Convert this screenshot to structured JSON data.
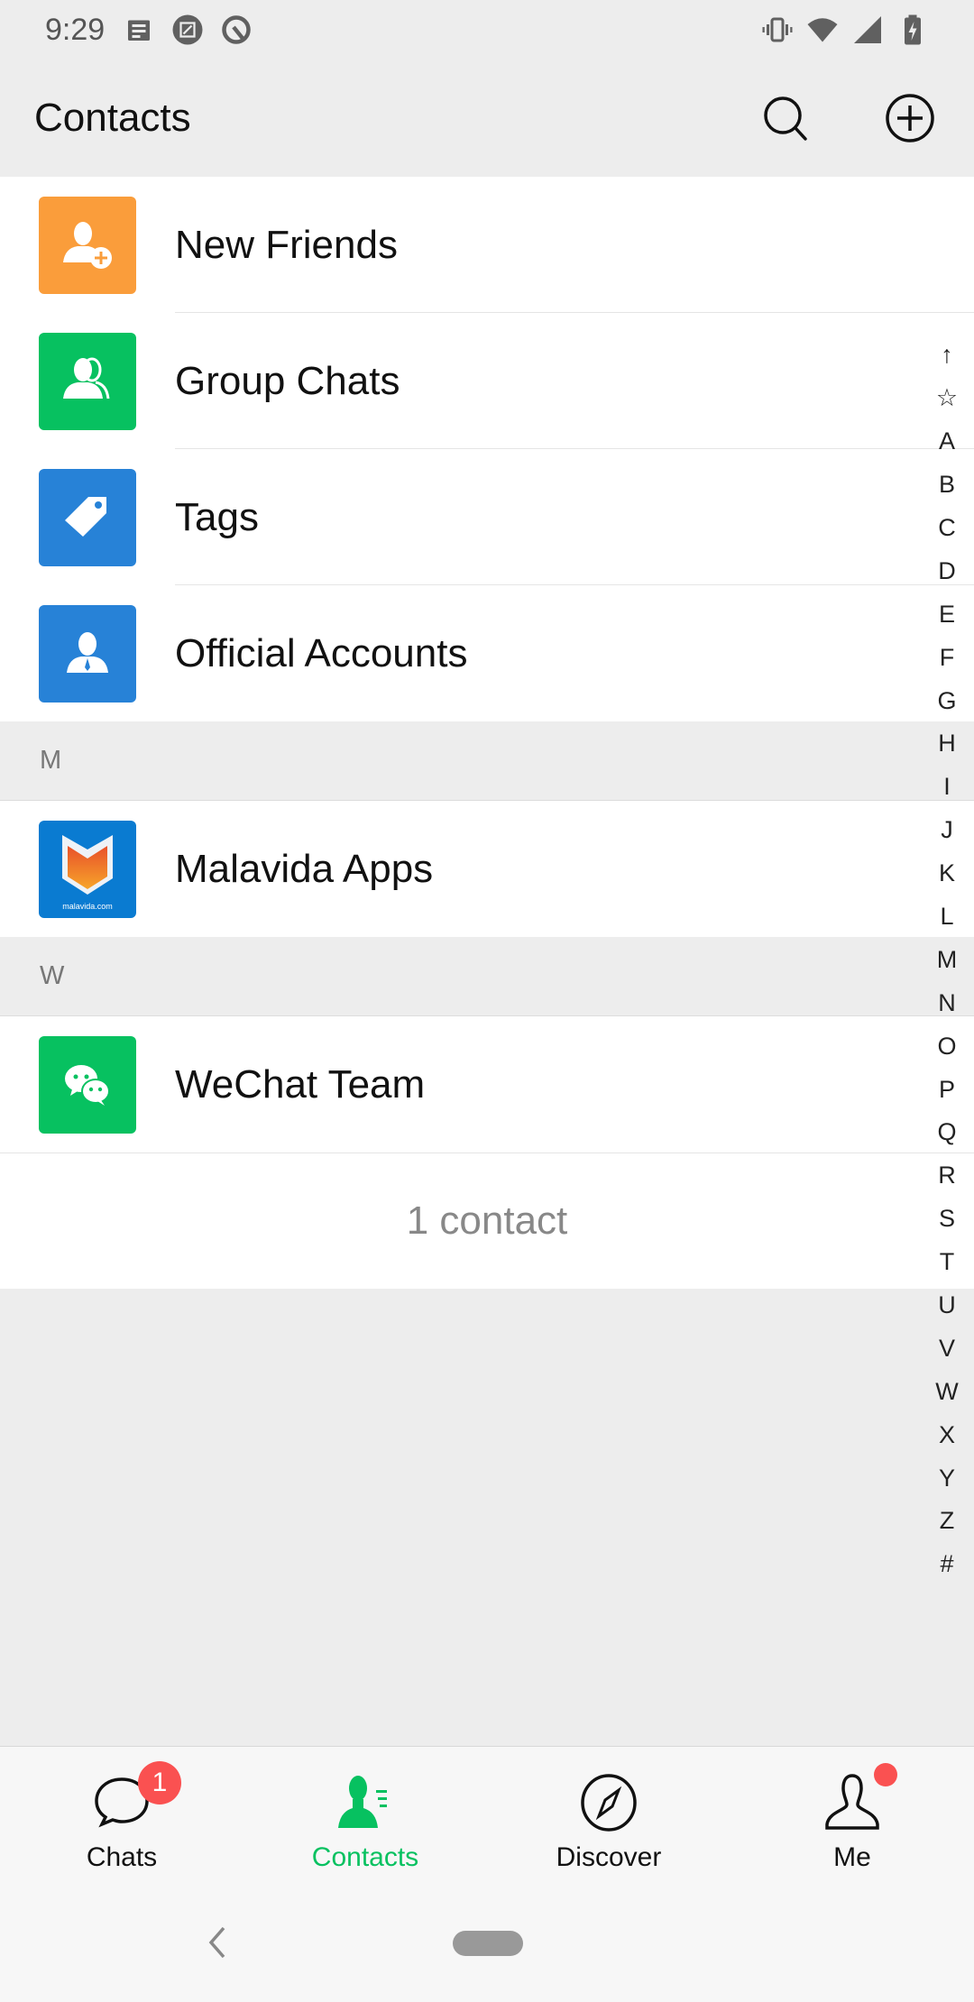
{
  "status_bar": {
    "time": "9:29",
    "left_icons": [
      "news-icon",
      "screenshot-edit-icon",
      "q-app-icon"
    ],
    "right_icons": [
      "vibrate-icon",
      "wifi-icon",
      "cellular-signal-icon",
      "battery-charging-icon"
    ]
  },
  "header": {
    "title": "Contacts",
    "search_icon": "search-icon",
    "add_icon": "add-circle-icon"
  },
  "colors": {
    "accent": "#07c160",
    "orange": "#fa9d3b",
    "blue": "#2782d7",
    "badge_red": "#fa5151",
    "background": "#ededed"
  },
  "shortcuts": [
    {
      "label": "New Friends",
      "icon": "add-friend-icon",
      "color": "#fa9d3b"
    },
    {
      "label": "Group Chats",
      "icon": "group-icon",
      "color": "#07c160"
    },
    {
      "label": "Tags",
      "icon": "tag-icon",
      "color": "#2782d7"
    },
    {
      "label": "Official Accounts",
      "icon": "official-account-icon",
      "color": "#2782d7"
    }
  ],
  "sections": [
    {
      "letter": "M",
      "contacts": [
        {
          "name": "Malavida Apps",
          "avatar_text": "malavida.com"
        }
      ]
    },
    {
      "letter": "W",
      "contacts": [
        {
          "name": "WeChat Team"
        }
      ]
    }
  ],
  "contact_count": "1 contact",
  "index_letters": [
    "↑",
    "☆",
    "A",
    "B",
    "C",
    "D",
    "E",
    "F",
    "G",
    "H",
    "I",
    "J",
    "K",
    "L",
    "M",
    "N",
    "O",
    "P",
    "Q",
    "R",
    "S",
    "T",
    "U",
    "V",
    "W",
    "X",
    "Y",
    "Z",
    "#"
  ],
  "tabs": [
    {
      "label": "Chats",
      "icon": "chat-bubble-icon",
      "badge": "1",
      "active": false
    },
    {
      "label": "Contacts",
      "icon": "contacts-icon",
      "active": true
    },
    {
      "label": "Discover",
      "icon": "compass-icon",
      "active": false
    },
    {
      "label": "Me",
      "icon": "person-icon",
      "dot": true,
      "active": false
    }
  ]
}
